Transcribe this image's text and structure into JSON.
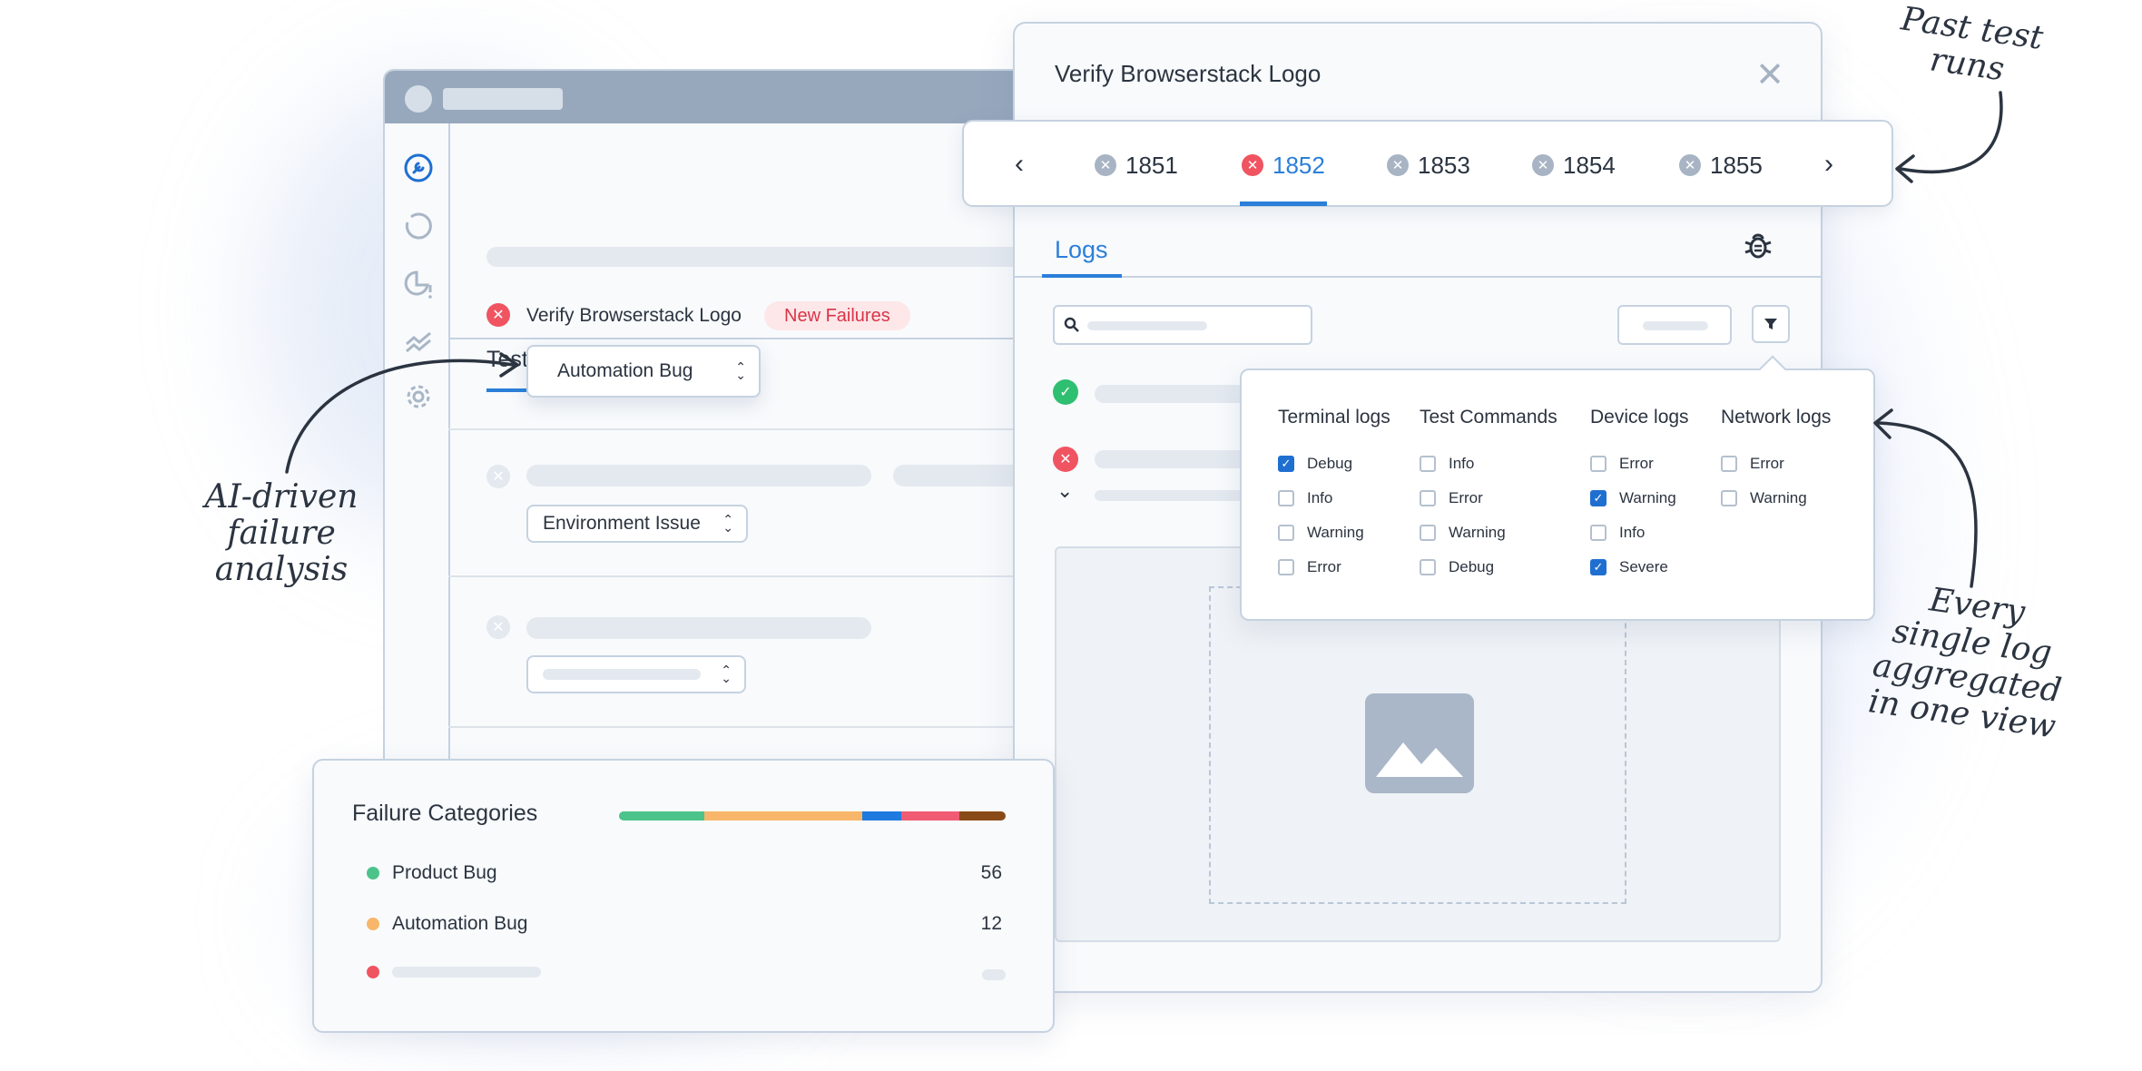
{
  "tests_window": {
    "tab_label": "Tests",
    "failing_test": {
      "name": "Verify Browserstack Logo",
      "badge": "New Failures",
      "category": "Automation Bug"
    },
    "second_row": {
      "category": "Environment Issue"
    }
  },
  "details_window": {
    "title": "Verify Browserstack Logo",
    "logs_tab": "Logs"
  },
  "runs": {
    "items": [
      {
        "label": "1851",
        "active": false
      },
      {
        "label": "1852",
        "active": true
      },
      {
        "label": "1853",
        "active": false
      },
      {
        "label": "1854",
        "active": false
      },
      {
        "label": "1855",
        "active": false
      }
    ]
  },
  "log_filters": {
    "columns": [
      {
        "title": "Terminal logs",
        "options": [
          {
            "label": "Debug",
            "checked": true
          },
          {
            "label": "Info",
            "checked": false
          },
          {
            "label": "Warning",
            "checked": false
          },
          {
            "label": "Error",
            "checked": false
          }
        ]
      },
      {
        "title": "Test Commands",
        "options": [
          {
            "label": "Info",
            "checked": false
          },
          {
            "label": "Error",
            "checked": false
          },
          {
            "label": "Warning",
            "checked": false
          },
          {
            "label": "Debug",
            "checked": false
          }
        ]
      },
      {
        "title": "Device logs",
        "options": [
          {
            "label": "Error",
            "checked": false
          },
          {
            "label": "Warning",
            "checked": true
          },
          {
            "label": "Info",
            "checked": false
          },
          {
            "label": "Severe",
            "checked": true
          }
        ]
      },
      {
        "title": "Network logs",
        "options": [
          {
            "label": "Error",
            "checked": false
          },
          {
            "label": "Warning",
            "checked": false
          }
        ]
      }
    ]
  },
  "failure_categories": {
    "title": "Failure Categories",
    "items": [
      {
        "label": "Product Bug",
        "count": "56",
        "color": "#4cc38a"
      },
      {
        "label": "Automation Bug",
        "count": "12",
        "color": "#f8b66a"
      }
    ],
    "third_dot_color": "#f05461",
    "bar_segments": [
      {
        "color": "#4cc38a",
        "share": 0.22
      },
      {
        "color": "#f8b66a",
        "share": 0.41
      },
      {
        "color": "#1f7ae0",
        "share": 0.1
      },
      {
        "color": "#f05b73",
        "share": 0.15
      },
      {
        "color": "#8a4a17",
        "share": 0.12
      }
    ]
  },
  "annotations": {
    "left_line1": "AI-driven",
    "left_line2": "failure",
    "left_line3": "analysis",
    "top_line1": "Past test",
    "top_line2": "runs",
    "right_line1": "Every",
    "right_line2": "single log",
    "right_line3": "aggregated",
    "right_line4": "in one view"
  },
  "colors": {
    "accent": "#2b7fd9",
    "error": "#f05461",
    "success": "#2fbf71"
  }
}
